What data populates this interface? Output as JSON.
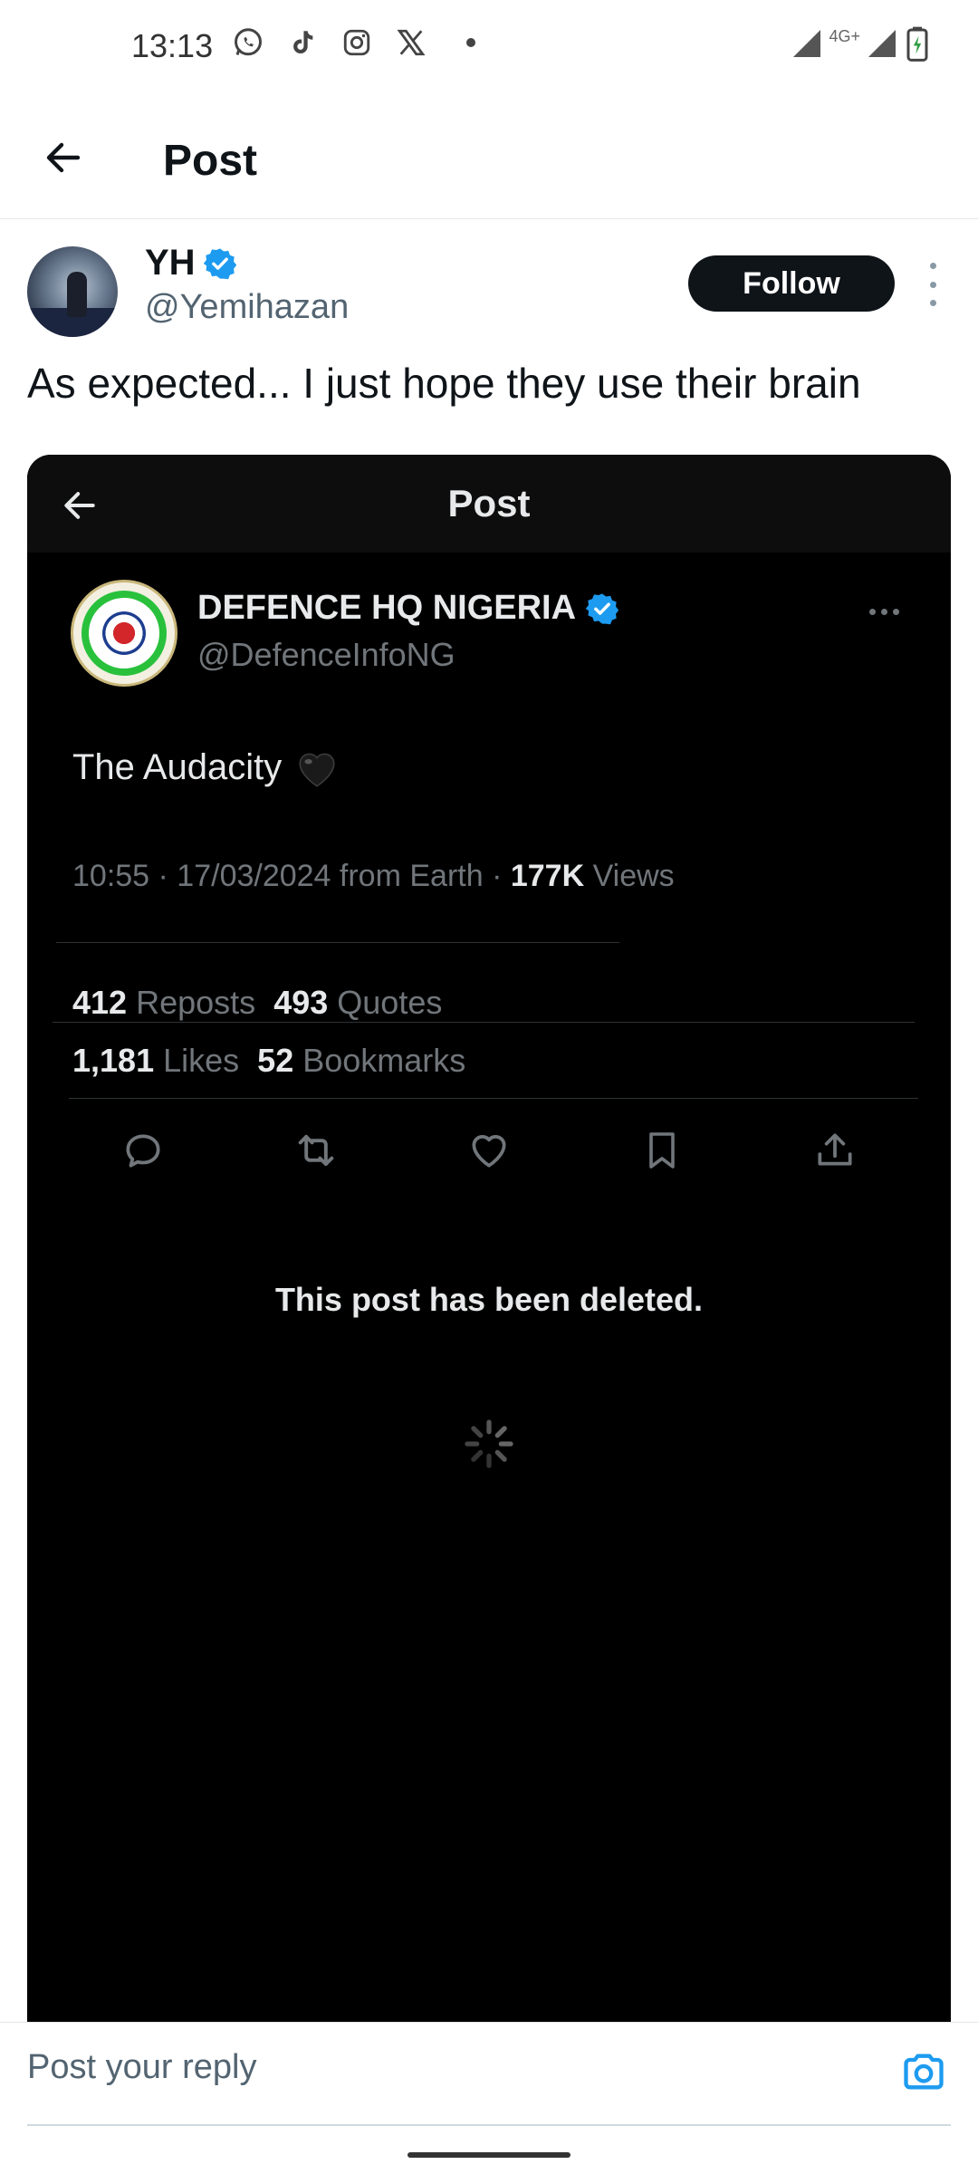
{
  "status_bar": {
    "time": "13:13",
    "network": "4G+",
    "icons": [
      "whatsapp-icon",
      "tiktok-icon",
      "instagram-icon",
      "x-icon",
      "dot-icon",
      "signal-icon",
      "battery-icon"
    ]
  },
  "header": {
    "title": "Post"
  },
  "tweet": {
    "author_name": "YH",
    "author_handle": "@Yemihazan",
    "follow_label": "Follow",
    "text": "As expected... I just hope they use their brain"
  },
  "embedded": {
    "header_title": "Post",
    "author_name": "DEFENCE HQ NIGERIA",
    "author_handle": "@DefenceInfoNG",
    "text": "The Audacity",
    "meta_prefix": "10:55 · 17/03/2024 from Earth · ",
    "views_count": "177K",
    "views_label": "Views",
    "reposts_count": "412",
    "reposts_label": "Reposts",
    "quotes_count": "493",
    "quotes_label": "Quotes",
    "likes_count": "1,181",
    "likes_label": "Likes",
    "bookmarks_count": "52",
    "bookmarks_label": "Bookmarks",
    "deleted_notice": "This post has been deleted."
  },
  "reply": {
    "placeholder": "Post your reply"
  },
  "colors": {
    "verified": "#1d9bf0",
    "follow_bg": "#0f1419",
    "embed_bg": "#000000",
    "muted": "#536471"
  }
}
